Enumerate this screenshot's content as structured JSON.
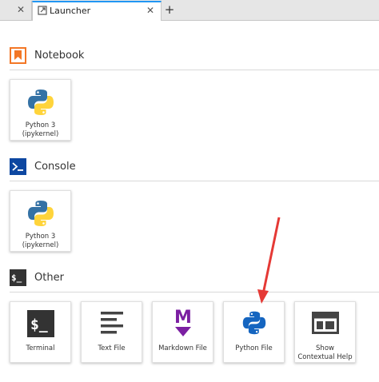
{
  "tabs": [
    {
      "label": "",
      "close": "✕"
    },
    {
      "label": "Launcher",
      "close": "✕"
    }
  ],
  "add_tab": "+",
  "sections": {
    "notebook": {
      "title": "Notebook",
      "icon": "notebook-bookmark-icon",
      "items": [
        {
          "line1": "Python 3",
          "line2": "(ipykernel)",
          "icon": "python-logo-icon"
        }
      ]
    },
    "console": {
      "title": "Console",
      "icon": "console-prompt-icon",
      "items": [
        {
          "line1": "Python 3",
          "line2": "(ipykernel)",
          "icon": "python-logo-icon"
        }
      ]
    },
    "other": {
      "title": "Other",
      "icon": "other-terminal-icon",
      "items": [
        {
          "label": "Terminal",
          "icon": "terminal-icon"
        },
        {
          "label": "Text File",
          "icon": "text-file-icon"
        },
        {
          "label": "Markdown File",
          "icon": "markdown-icon"
        },
        {
          "label": "Python File",
          "icon": "python-file-icon"
        },
        {
          "label": "Show Contextual Help",
          "icon": "contextual-help-icon"
        }
      ]
    }
  },
  "annotation": {
    "type": "red-arrow",
    "points_to": "Python File"
  },
  "colors": {
    "accent_tab": "#2196f3",
    "notebook_icon": "#f37726",
    "console_icon": "#0d47a1",
    "other_icon": "#333333",
    "markdown": "#7b1fa2",
    "python_blue": "#3572a5",
    "python_yellow": "#ffd43b",
    "arrow": "#e53935"
  }
}
